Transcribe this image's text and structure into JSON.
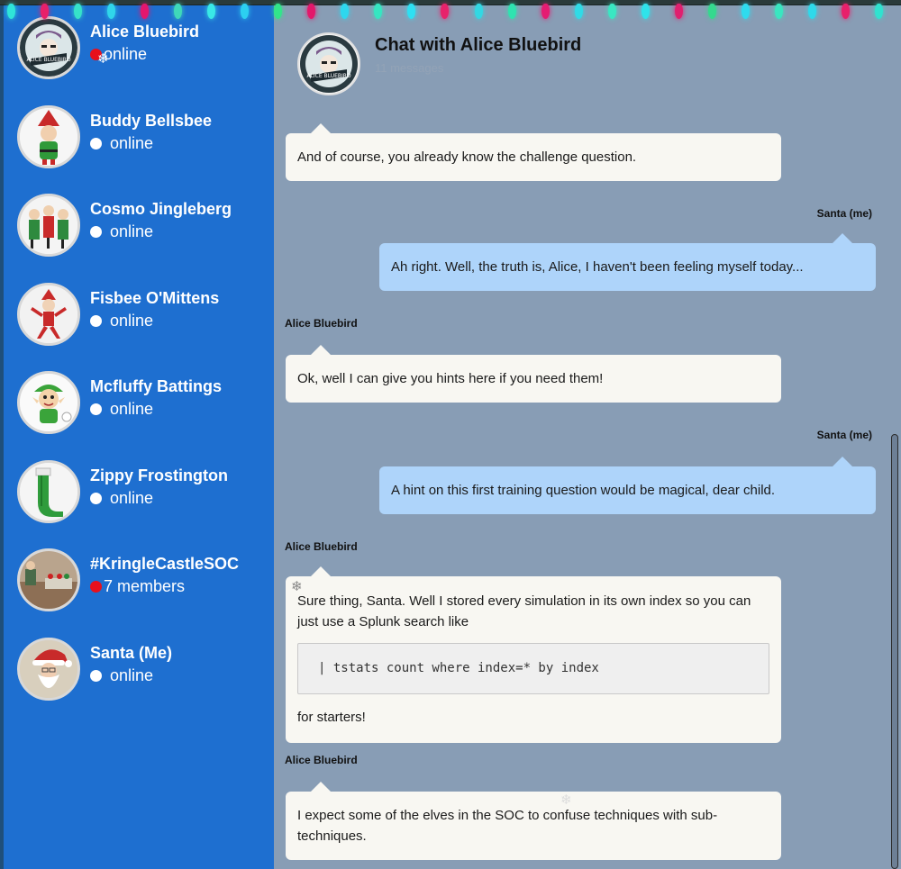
{
  "lights": {
    "colors": [
      "#2fe5d8",
      "#e8206a",
      "#36e2c9",
      "#30d6ea",
      "#e3166e",
      "#3fd8b9",
      "#39e9e6",
      "#2ccff1",
      "#32e58a",
      "#e3186b",
      "#2ed7ee",
      "#36e6c1",
      "#2ee0f2",
      "#e8226b",
      "#32d8e3",
      "#2fe3b0",
      "#e51c72",
      "#30dbe6",
      "#3ae7c2",
      "#2fe3ea",
      "#e0206f",
      "#35d98e",
      "#2fdbee",
      "#39e6c0",
      "#2fd9ea",
      "#e8206b",
      "#30e2cf"
    ]
  },
  "contacts": [
    {
      "name": "Alice Bluebird",
      "status": "online",
      "dot": "red",
      "avatar": "alice-avatar"
    },
    {
      "name": "Buddy Bellsbee",
      "status": "online",
      "dot": "white",
      "avatar": "elf-avatar"
    },
    {
      "name": "Cosmo Jingleberg",
      "status": "online",
      "dot": "white",
      "avatar": "elf-group-avatar"
    },
    {
      "name": "Fisbee O'Mittens",
      "status": "online",
      "dot": "white",
      "avatar": "elf-doll-avatar"
    },
    {
      "name": "Mcfluffy Battings",
      "status": "online",
      "dot": "white",
      "avatar": "cartoon-elf-avatar"
    },
    {
      "name": "Zippy Frostington",
      "status": "online",
      "dot": "white",
      "avatar": "stocking-avatar"
    },
    {
      "name": "#KringleCastleSOC",
      "status": "7 members",
      "dot": "red",
      "avatar": "soc-room-avatar"
    },
    {
      "name": "Santa (Me)",
      "status": "online",
      "dot": "white",
      "avatar": "santa-avatar"
    }
  ],
  "chat": {
    "title": "Chat with Alice Bluebird",
    "subtitle": "11 messages",
    "messages": [
      {
        "from": "them",
        "sender": "",
        "text": "And of course, you already know the challenge question."
      },
      {
        "from": "me",
        "sender": "Santa (me)",
        "text": "Ah right. Well, the truth is, Alice, I haven't been feeling myself today..."
      },
      {
        "from": "them",
        "sender": "Alice Bluebird",
        "text": "Ok, well I can give you hints here if you need them!"
      },
      {
        "from": "me",
        "sender": "Santa (me)",
        "text": "A hint on this first training question would be magical, dear child."
      },
      {
        "from": "them",
        "sender": "Alice Bluebird",
        "text": "Sure thing, Santa. Well I stored every simulation in its own index so you can just use a Splunk search like",
        "code": "| tstats count where index=* by index",
        "after": "for starters!"
      },
      {
        "from": "them",
        "sender": "Alice Bluebird",
        "text": "I expect some of the elves in the SOC to confuse techniques with sub-techniques."
      }
    ]
  }
}
